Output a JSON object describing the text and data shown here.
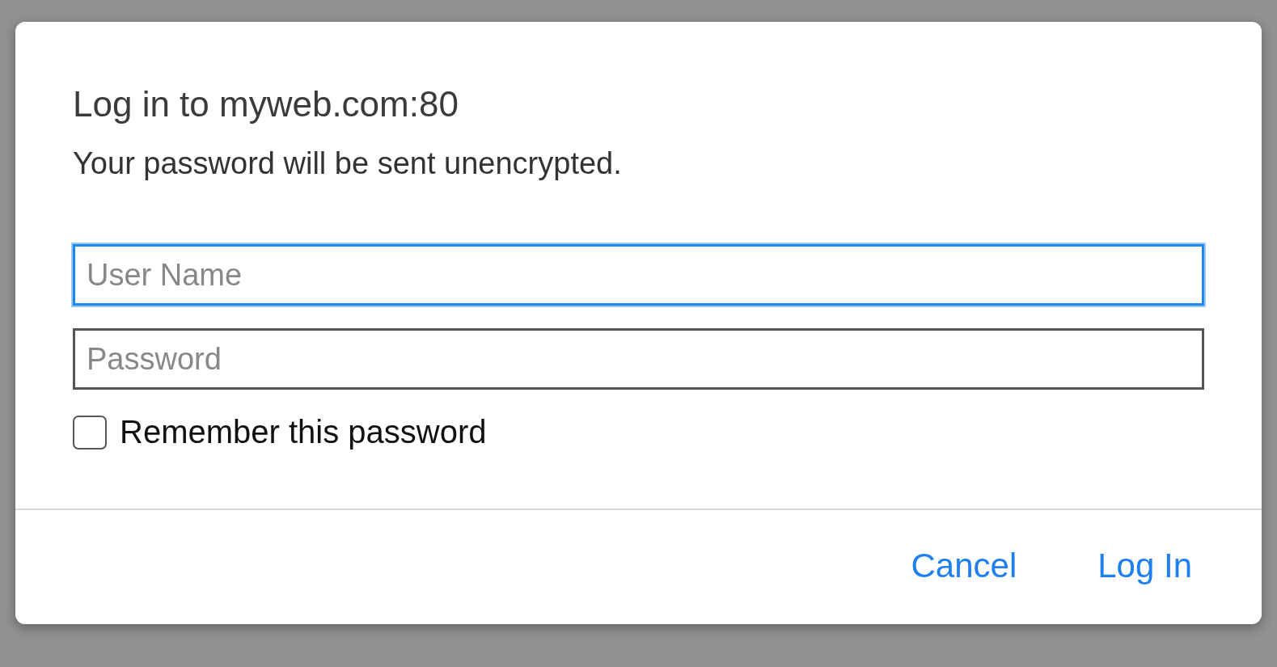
{
  "dialog": {
    "title": "Log in to myweb.com:80",
    "message": "Your password will be sent unencrypted."
  },
  "fields": [
    {
      "placeholder": "User Name",
      "focused": true
    },
    {
      "placeholder": "Password",
      "focused": false
    }
  ],
  "remember": {
    "label": "Remember this password",
    "checked": false
  },
  "buttons": [
    "Cancel",
    "Log In"
  ]
}
